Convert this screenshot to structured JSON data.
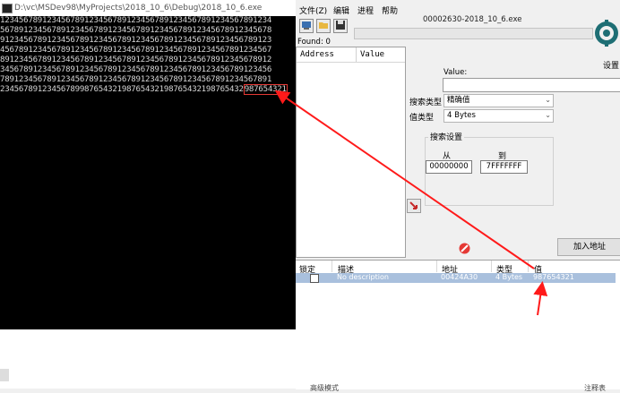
{
  "console": {
    "title": "D:\\vc\\MSDev98\\MyProjects\\2018_10_6\\Debug\\2018_10_6.exe",
    "lines": [
      "1234567891234567891234567891234567891234567891234567891234",
      "5678912345678912345678912345678912345678912345678912345678",
      "9123456789123456789123456789123456789123456789123456789123",
      "4567891234567891234567891234567891234567891234567891234567",
      "8912345678912345678912345678912345678912345678912345678912",
      "3456789123456789123456789123456789123456789123456789123456",
      "7891234567891234567891234567891234567891234567891234567891",
      "2345678912345678998765432198765432198765432198765432"
    ],
    "highlight": "987654321"
  },
  "ce": {
    "menu": [
      "文件(Z)",
      "编辑",
      "进程",
      "帮助"
    ],
    "process_title": "00002630-2018_10_6.exe",
    "found": "Found: 0",
    "address_list_headers": [
      "Address",
      "Value"
    ],
    "settings_label": "设置",
    "value_label": "Value:",
    "scan_type_label": "搜索类型",
    "scan_type_value": "精确值",
    "value_type_label": "值类型",
    "value_type_value": "4 Bytes",
    "search_settings_label": "搜索设置",
    "from_label": "从",
    "to_label": "到",
    "from_value": "00000000",
    "to_value": "7FFFFFFF",
    "add_address_button": "加入地址",
    "table_headers": [
      "锁定",
      "描述",
      "地址",
      "类型",
      "值"
    ],
    "row": {
      "description": "No description",
      "address": "00424A30",
      "type": "4 Bytes",
      "value": "987654321"
    },
    "footer_left": "高级模式",
    "footer_right": "注释表"
  },
  "colors": {
    "console_bg": "#000000",
    "highlight_border": "#e53935",
    "arrow": "#ff1a1a",
    "row_selected": "#a9c0dd"
  }
}
